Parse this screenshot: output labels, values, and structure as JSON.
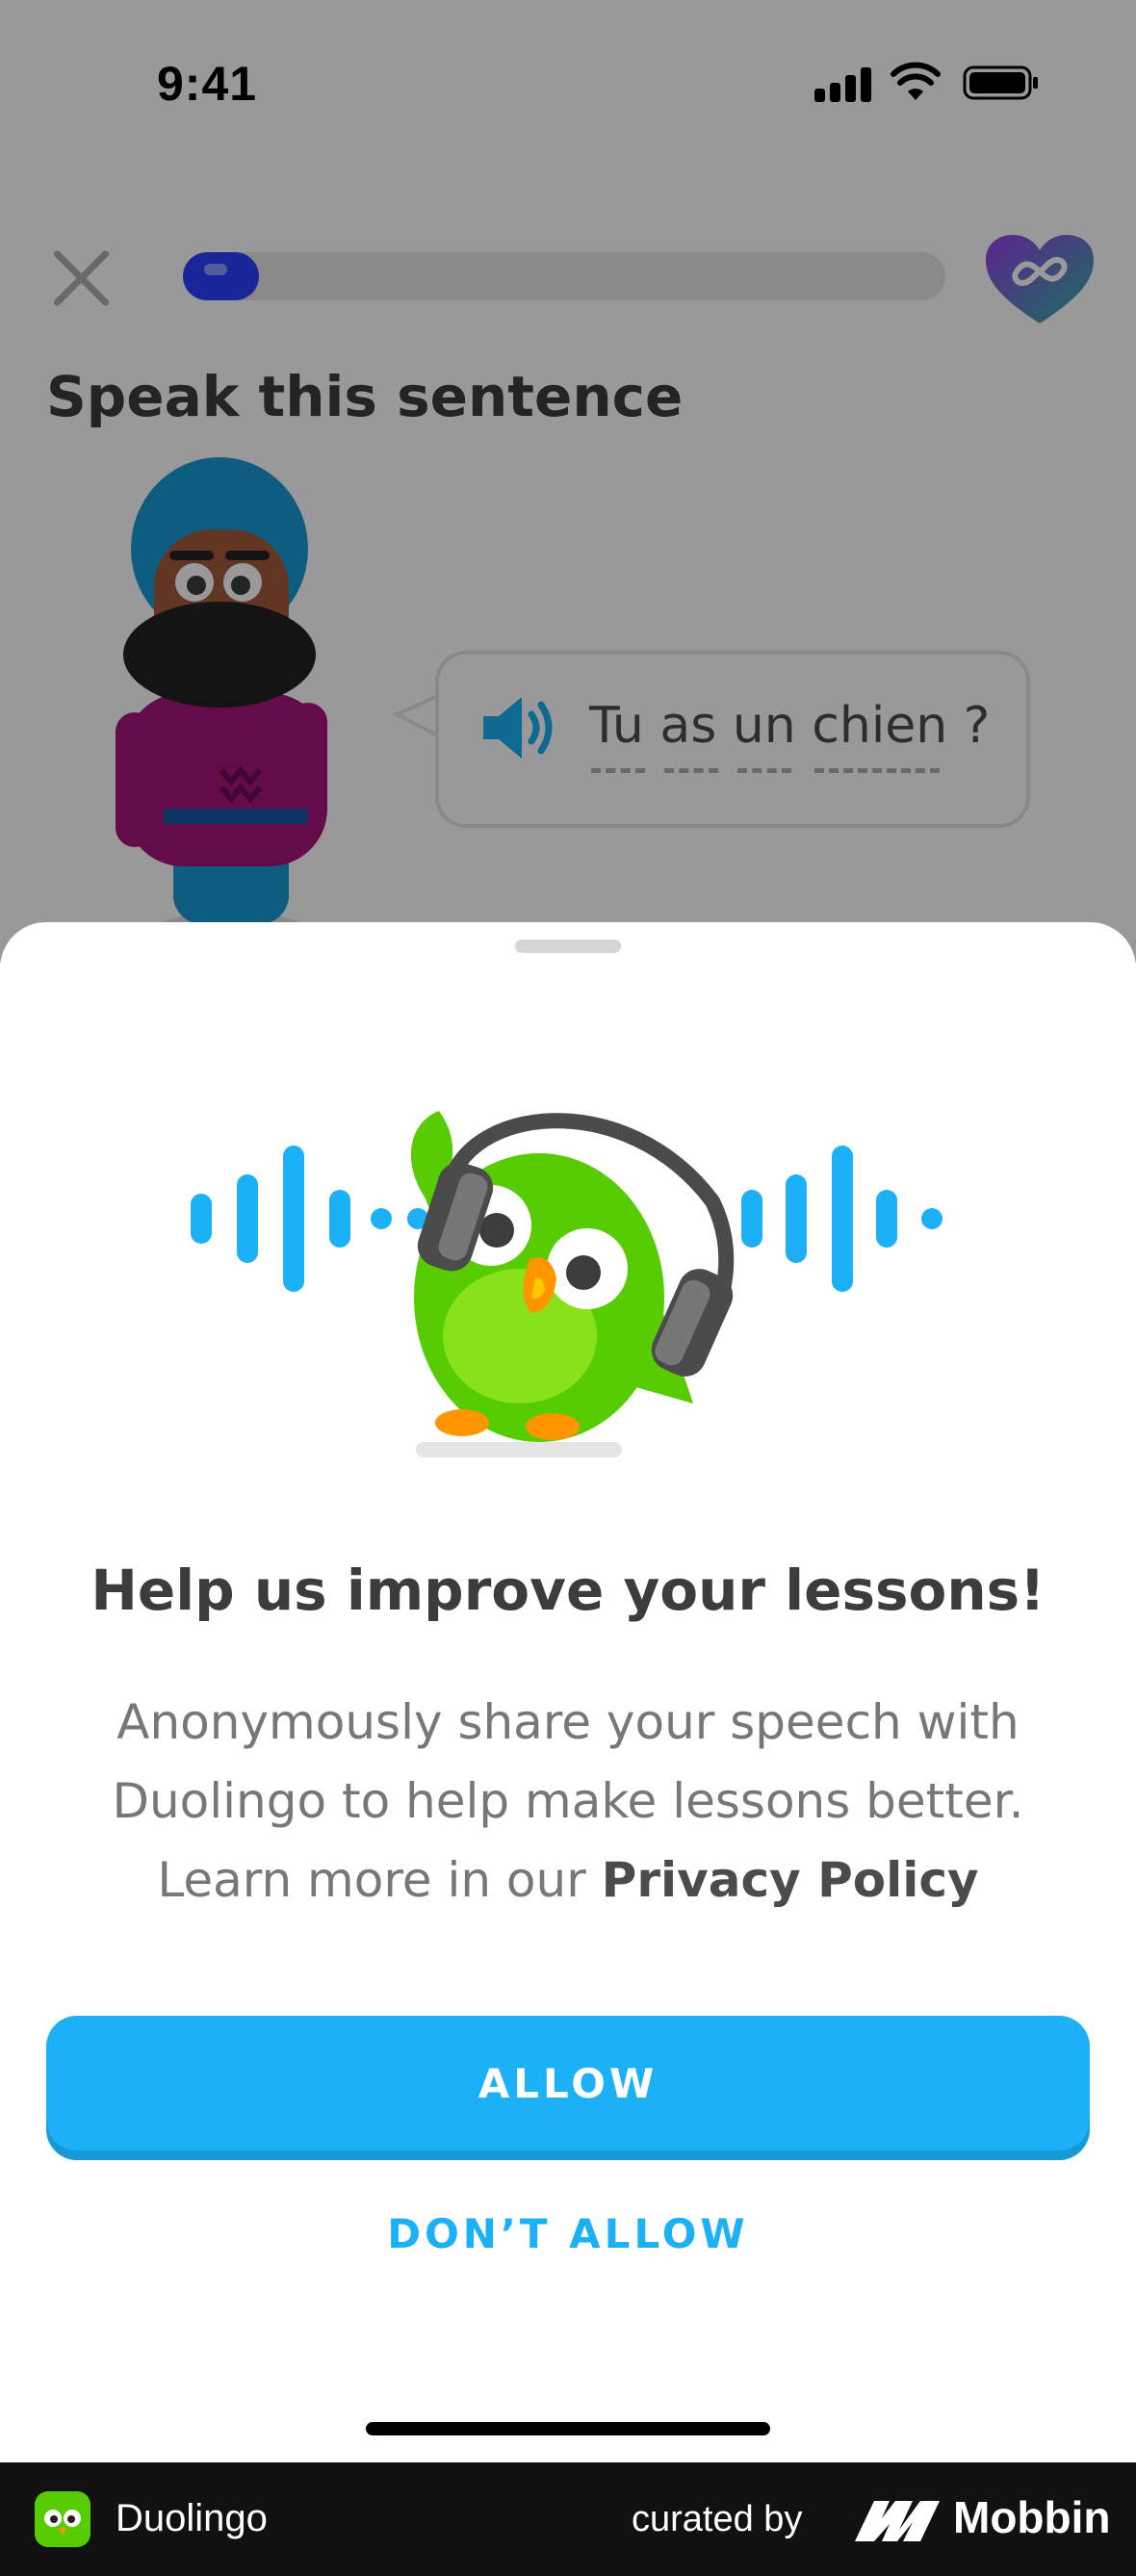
{
  "status_bar": {
    "time": "9:41"
  },
  "lesson": {
    "progress_fraction": 0.1,
    "title": "Speak this sentence",
    "sentence": "Tu as un chien ?",
    "hearts_icon": "infinity-heart-icon"
  },
  "sheet": {
    "title": "Help us improve your lessons!",
    "body_line1": "Anonymously share your speech with",
    "body_line2": "Duolingo to help make lessons better.",
    "body_line3_prefix": "Learn more in our ",
    "privacy_link": "Privacy Policy",
    "allow_label": "ALLOW",
    "deny_label": "DON’T ALLOW"
  },
  "footer": {
    "app_name": "Duolingo",
    "curated_by": "curated by",
    "brand": "Mobbin"
  },
  "colors": {
    "accent_blue": "#1cb0f6",
    "accent_blue_shadow": "#1899d6",
    "owl_green": "#58cc02",
    "progress_blue": "#2b40ff"
  }
}
